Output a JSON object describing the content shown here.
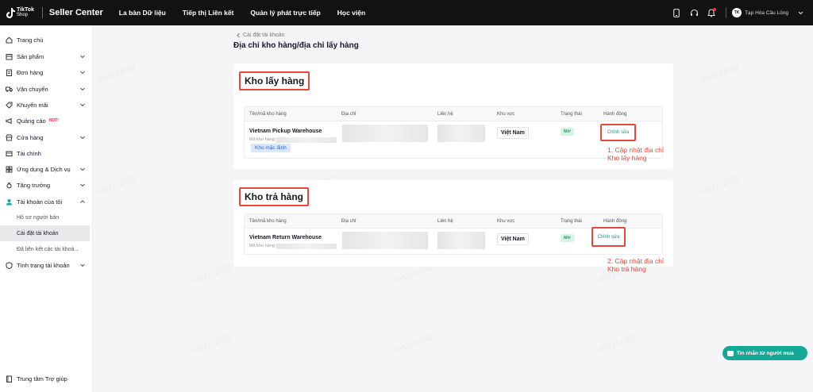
{
  "topbar": {
    "logo_line1": "TikTok",
    "logo_line2": "Shop",
    "brand": "Seller Center",
    "nav": [
      "La bàn Dữ liệu",
      "Tiếp thị Liên kết",
      "Quản lý phát trực tiếp",
      "Học viện"
    ],
    "user_initials": "TK",
    "user_name": "Tạp Hóa Cầu Lông"
  },
  "sidebar": {
    "items": [
      {
        "label": "Trang chủ",
        "icon": "home-icon"
      },
      {
        "label": "Sản phẩm",
        "icon": "box-icon"
      },
      {
        "label": "Đơn hàng",
        "icon": "order-icon"
      },
      {
        "label": "Vận chuyển",
        "icon": "truck-icon"
      },
      {
        "label": "Khuyến mãi",
        "icon": "promo-icon"
      },
      {
        "label": "Quảng cáo",
        "icon": "megaphone-icon",
        "badge": "HOT!"
      },
      {
        "label": "Cửa hàng",
        "icon": "store-icon"
      },
      {
        "label": "Tài chính",
        "icon": "wallet-icon"
      },
      {
        "label": "Ứng dụng & Dịch vụ",
        "icon": "apps-icon"
      },
      {
        "label": "Tăng trưởng",
        "icon": "medal-icon"
      },
      {
        "label": "Tài khoản của tôi",
        "icon": "user-icon"
      },
      {
        "label": "Tình trạng tài khoản",
        "icon": "shield-icon"
      }
    ],
    "sub_items": [
      "Hồ sơ người bán",
      "Cài đặt tài khoản",
      "Đã liên kết các tài khoả..."
    ],
    "help": "Trung tâm Trợ giúp"
  },
  "breadcrumb": "Cài đặt tài khoản",
  "page_title": "Địa chỉ kho hàng/địa chỉ lấy hàng",
  "columns": [
    "Tên/mã kho hàng",
    "Địa chỉ",
    "Liên hệ",
    "Khu vực",
    "Trạng thái",
    "Hành động"
  ],
  "pickup": {
    "title": "Kho lấy hàng",
    "name": "Vietnam Pickup Warehouse",
    "code_label": "Mã kho hàng:",
    "default_tag": "Kho mặc định",
    "region": "Việt Nam",
    "status": "Mở",
    "action": "Chỉnh sửa",
    "annotation": "1. Cập nhật địa chỉ Kho lấy hàng"
  },
  "return": {
    "title": "Kho trả hàng",
    "name": "Vietnam Return Warehouse",
    "code_label": "Mã kho hàng:",
    "region": "Việt Nam",
    "status": "Mở",
    "action": "Chỉnh sửa",
    "annotation": "2. Cập nhật địa chỉ Kho trả hàng"
  },
  "watermark_text": "viet1112002",
  "chat_button": "Tin nhắn từ người mua",
  "colors": {
    "accent": "#13a996",
    "highlight": "#e8483b",
    "topbar": "#121212"
  }
}
